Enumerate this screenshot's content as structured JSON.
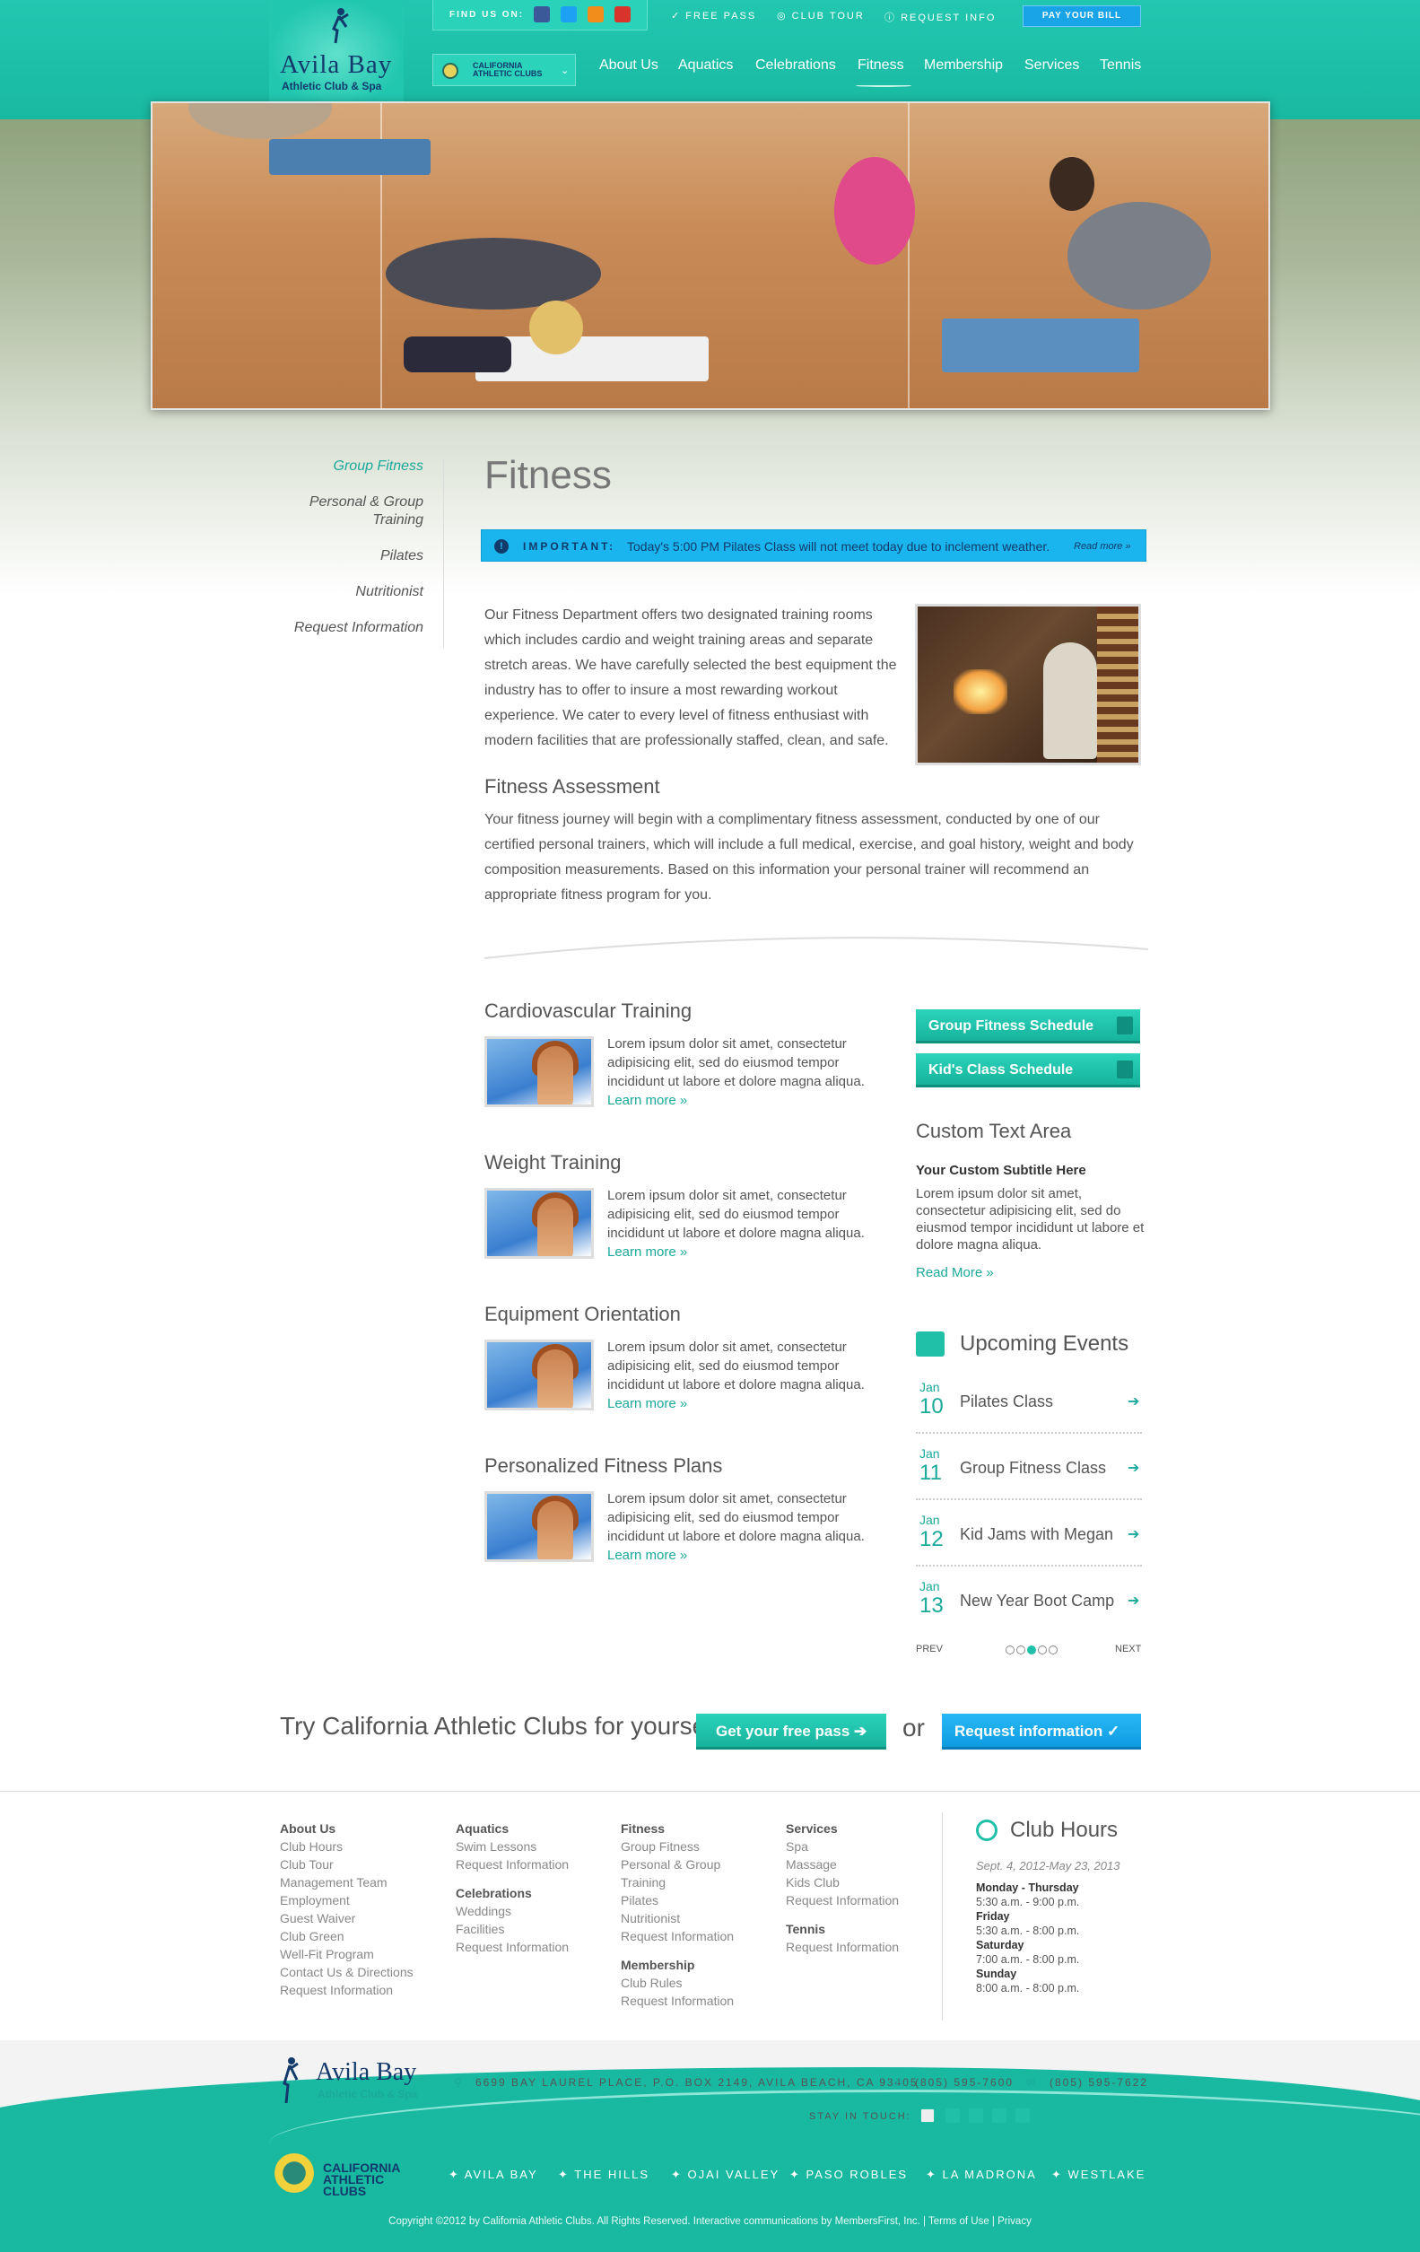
{
  "header": {
    "logo": {
      "title": "Avila Bay",
      "subtitle": "Athletic Club & Spa"
    },
    "find_us": "FIND US ON:",
    "top_links": [
      "FREE PASS",
      "CLUB TOUR",
      "REQUEST INFO"
    ],
    "pay_bill": "PAY YOUR BILL",
    "club_select": "CALIFORNIA ATHLETIC CLUBS",
    "nav": [
      "About Us",
      "Aquatics",
      "Celebrations",
      "Fitness",
      "Membership",
      "Services",
      "Tennis"
    ],
    "active_nav": "Fitness"
  },
  "sidenav": {
    "items": [
      "Group Fitness",
      "Personal & Group Training",
      "Pilates",
      "Nutritionist",
      "Request Information"
    ],
    "active": "Group Fitness"
  },
  "main": {
    "title": "Fitness",
    "notice": {
      "label": "IMPORTANT:",
      "message": "Today's 5:00 PM Pilates Class will not meet today due to inclement weather.",
      "read_more": "Read more »"
    },
    "intro": "Our Fitness Department offers two designated training rooms which includes cardio and weight training areas and separate stretch areas.  We have carefully selected the best equipment the industry has to offer to insure a most rewarding workout experience.  We cater to every level of fitness enthusiast with modern facilities that are professionally staffed, clean, and safe.",
    "assessment_title": "Fitness Assessment",
    "assessment_text": "Your fitness journey will begin with a complimentary fitness assessment, conducted by one of our certified personal trainers, which will include a full medical, exercise, and goal history, weight and body composition measurements.  Based on this information your personal trainer will recommend an appropriate fitness program for you.",
    "services": [
      {
        "title": "Cardiovascular Training",
        "text": "Lorem ipsum dolor sit amet, consectetur adipisicing elit, sed do eiusmod tempor incididunt ut labore et dolore magna aliqua.",
        "link": "Learn more »"
      },
      {
        "title": "Weight Training",
        "text": "Lorem ipsum dolor sit amet, consectetur adipisicing elit, sed do eiusmod tempor incididunt ut labore et dolore magna aliqua.",
        "link": "Learn more »"
      },
      {
        "title": "Equipment Orientation",
        "text": "Lorem ipsum dolor sit amet, consectetur adipisicing elit, sed do eiusmod tempor incididunt ut labore et dolore magna aliqua.",
        "link": "Learn more »"
      },
      {
        "title": "Personalized Fitness Plans",
        "text": "Lorem ipsum dolor sit amet, consectetur adipisicing elit, sed do eiusmod tempor incididunt ut labore et dolore magna aliqua.",
        "link": "Learn more »"
      }
    ]
  },
  "sidebar": {
    "buttons": [
      "Group Fitness Schedule",
      "Kid's Class Schedule"
    ],
    "custom": {
      "title": "Custom Text Area",
      "subtitle": "Your Custom Subtitle Here",
      "text": "Lorem ipsum dolor sit amet, consectetur adipisicing elit, sed do eiusmod tempor incididunt ut labore et dolore magna aliqua.",
      "link": "Read More »"
    },
    "events_title": "Upcoming Events",
    "events": [
      {
        "month": "Jan",
        "day": "10",
        "name": "Pilates Class"
      },
      {
        "month": "Jan",
        "day": "11",
        "name": "Group Fitness Class"
      },
      {
        "month": "Jan",
        "day": "12",
        "name": "Kid Jams with Megan"
      },
      {
        "month": "Jan",
        "day": "13",
        "name": "New Year Boot Camp"
      }
    ],
    "pager": {
      "prev": "PREV",
      "next": "NEXT"
    }
  },
  "cta": {
    "text": "Try California Athletic Clubs for yourself.",
    "free_pass": "Get your free pass",
    "or": "or",
    "request": "Request information"
  },
  "footer_links": [
    {
      "groups": [
        {
          "heading": "About Us",
          "items": [
            "Club Hours",
            "Club Tour",
            "Management Team",
            "Employment",
            "Guest Waiver",
            "Club Green",
            "Well-Fit Program",
            "Contact Us & Directions",
            "Request Information"
          ]
        }
      ]
    },
    {
      "groups": [
        {
          "heading": "Aquatics",
          "items": [
            "Swim Lessons",
            "Request Information"
          ]
        },
        {
          "heading": "Celebrations",
          "items": [
            "Weddings",
            "Facilities",
            "Request Information"
          ]
        }
      ]
    },
    {
      "groups": [
        {
          "heading": "Fitness",
          "items": [
            "Group Fitness",
            "Personal & Group",
            "Training",
            "Pilates",
            "Nutritionist",
            "Request Information"
          ]
        },
        {
          "heading": "Membership",
          "items": [
            "Club Rules",
            "Request Information"
          ]
        }
      ]
    },
    {
      "groups": [
        {
          "heading": "Services",
          "items": [
            "Spa",
            "Massage",
            "Kids Club",
            "Request Information"
          ]
        },
        {
          "heading": "Tennis",
          "items": [
            "Request Information"
          ]
        }
      ]
    }
  ],
  "hours": {
    "title": "Club Hours",
    "date": "Sept. 4, 2012-May 23, 2013",
    "entries": [
      {
        "day": "Monday - Thursday",
        "time": "5:30 a.m. - 9:00 p.m."
      },
      {
        "day": "Friday",
        "time": "5:30 a.m. - 8:00 p.m."
      },
      {
        "day": "Saturday",
        "time": "7:00 a.m. - 8:00 p.m."
      },
      {
        "day": "Sunday",
        "time": "8:00 a.m. - 8:00 p.m."
      }
    ]
  },
  "footer": {
    "logo_title": "Avila Bay",
    "logo_subtitle": "Athletic Club & Spa",
    "address": "6699 BAY LAUREL PLACE, P.O. BOX 2149, AVILA BEACH, CA 93405",
    "phone": "(805) 595-7600",
    "fax": "(805) 595-7622",
    "stay_in_touch": "STAY IN TOUCH:",
    "cac": "CALIFORNIA ATHLETIC CLUBS",
    "clubs": [
      "AVILA BAY",
      "THE HILLS",
      "OJAI VALLEY",
      "PASO ROBLES",
      "LA MADRONA",
      "WESTLAKE"
    ],
    "copyright": "Copyright ©2012 by California Athletic Clubs. All Rights Reserved. Interactive communications by MembersFirst, Inc.  |  Terms of Use  |  Privacy"
  },
  "colors": {
    "teal": "#1fbfa8",
    "blue": "#1ab5ee",
    "navy": "#123a6b"
  }
}
